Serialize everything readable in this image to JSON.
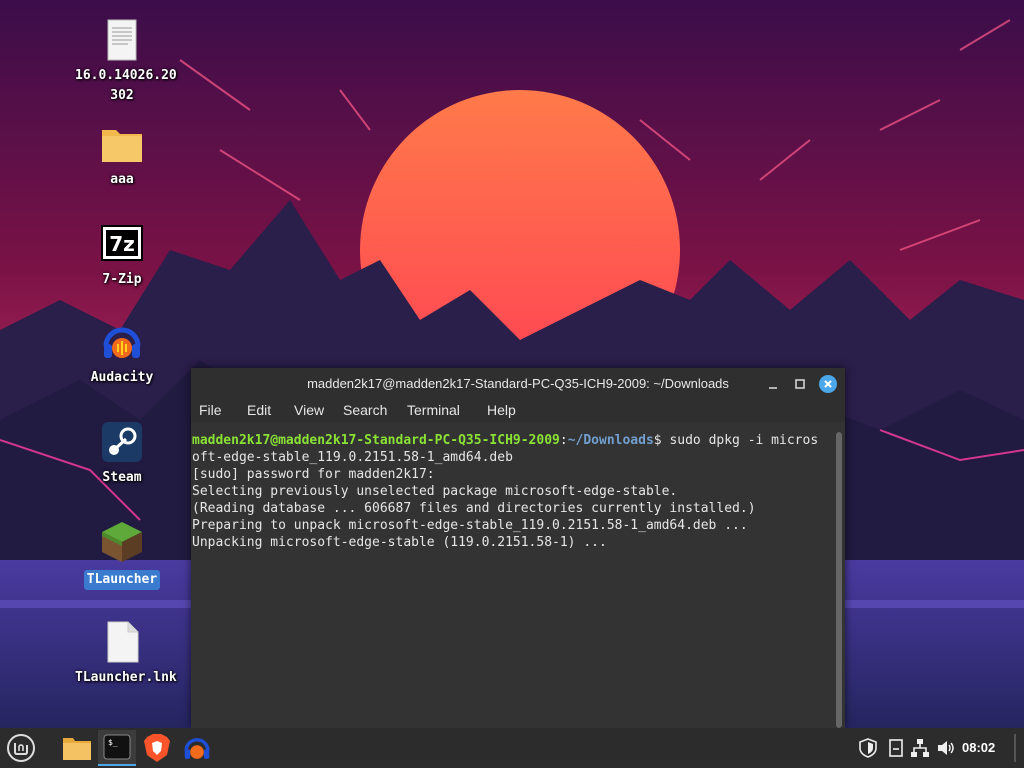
{
  "desktop": {
    "icons": [
      {
        "label": "16.0.14026.20302",
        "line1": "16.0.14026.20",
        "line2": "302",
        "icon": "document-icon"
      },
      {
        "label": "aaa",
        "icon": "folder-icon"
      },
      {
        "label": "7-Zip",
        "icon": "7zip-icon"
      },
      {
        "label": "Audacity",
        "icon": "audacity-icon"
      },
      {
        "label": "Steam",
        "icon": "steam-icon"
      },
      {
        "label": "TLauncher",
        "icon": "minecraft-icon",
        "selected": true
      },
      {
        "label": "TLauncher.lnk",
        "icon": "file-icon"
      }
    ]
  },
  "terminal": {
    "title": "madden2k17@madden2k17-Standard-PC-Q35-ICH9-2009: ~/Downloads",
    "menu": [
      "File",
      "Edit",
      "View",
      "Search",
      "Terminal",
      "Help"
    ],
    "prompt_user": "madden2k17@madden2k17-Standard-PC-Q35-ICH9-2009",
    "prompt_sep": ":",
    "prompt_path": "~/Downloads",
    "prompt_end": "$ ",
    "command_line1": "sudo dpkg -i micros",
    "command_line2": "oft-edge-stable_119.0.2151.58-1_amd64.deb",
    "output": [
      "[sudo] password for madden2k17:",
      "Selecting previously unselected package microsoft-edge-stable.",
      "(Reading database ... 606687 files and directories currently installed.)",
      "Preparing to unpack microsoft-edge-stable_119.0.2151.58-1_amd64.deb ...",
      "Unpacking microsoft-edge-stable (119.0.2151.58-1) ..."
    ]
  },
  "taskbar": {
    "items": [
      "mint-menu-icon",
      "files-icon",
      "terminal-icon",
      "brave-icon",
      "audacity-icon"
    ],
    "tray": [
      "shield-icon",
      "notes-icon",
      "network-icon",
      "volume-icon"
    ],
    "clock": "08:02"
  },
  "colors": {
    "prompt_user": "#8ae234",
    "prompt_path": "#729fcf",
    "accent": "#4ca6ea"
  }
}
